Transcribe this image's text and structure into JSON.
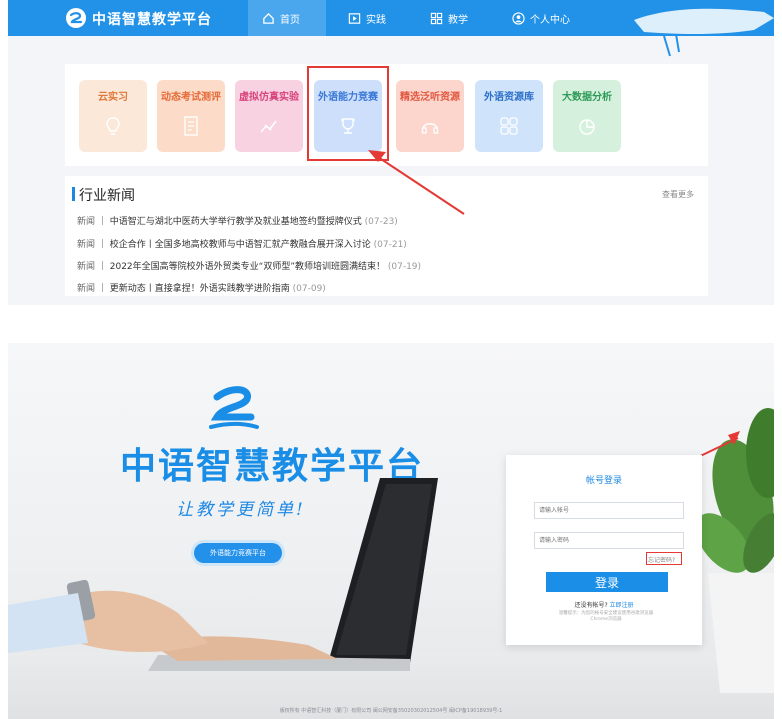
{
  "top": {
    "brand": "中语智慧教学平台",
    "nav": [
      {
        "label": "首页",
        "icon": "home-icon"
      },
      {
        "label": "实践",
        "icon": "play-icon"
      },
      {
        "label": "教学",
        "icon": "grid-icon"
      },
      {
        "label": "个人中心",
        "icon": "user-icon"
      }
    ],
    "cards": [
      {
        "title": "云实习",
        "icon": "lightbulb-icon",
        "bg": "#fbe8d8",
        "fg": "#e0783a"
      },
      {
        "title": "动态考试测评",
        "icon": "document-icon",
        "bg": "#fcdcc8",
        "fg": "#e56b3a"
      },
      {
        "title": "虚拟仿真实验",
        "icon": "chart-icon",
        "bg": "#f9d2e1",
        "fg": "#d9457c"
      },
      {
        "title": "外语能力竞赛",
        "icon": "trophy-icon",
        "bg": "#cddffb",
        "fg": "#3a78d8"
      },
      {
        "title": "精选泛听资源",
        "icon": "headphones-icon",
        "bg": "#fcd6cc",
        "fg": "#e2573f"
      },
      {
        "title": "外语资源库",
        "icon": "grid-icon",
        "bg": "#cfe3fb",
        "fg": "#2c6fc9"
      },
      {
        "title": "大数据分析",
        "icon": "pie-icon",
        "bg": "#d5f1de",
        "fg": "#2e9a57"
      }
    ],
    "news": {
      "title": "行业新闻",
      "more": "查看更多",
      "items": [
        {
          "tag": "新闻",
          "text": "中语智汇与湖北中医药大学举行教学及就业基地签约暨授牌仪式",
          "date": "(07-23)"
        },
        {
          "tag": "新闻",
          "text": "校企合作丨全国多地高校教师与中语智汇就产教融合展开深入讨论",
          "date": "(07-21)"
        },
        {
          "tag": "新闻",
          "text": "2022年全国高等院校外语外贸类专业“双师型”教师培训班圆满结束！",
          "date": "(07-19)"
        },
        {
          "tag": "新闻",
          "text": "更新动态丨直接拿捏！外语实践教学进阶指南",
          "date": "(07-09)"
        }
      ]
    }
  },
  "bottom": {
    "title": "中语智慧教学平台",
    "slogan": "让教学更简单!",
    "contest_button": "外语能力竞赛平台",
    "login": {
      "title": "帐号登录",
      "account_placeholder": "请输入帐号",
      "password_placeholder": "请输入密码",
      "forgot": "忘记密码?",
      "submit": "登录",
      "register_prompt": "还没有帐号?",
      "register_link": "立即注册",
      "tip": "温馨提示：为您的帐号安全建议使用谷歌浏览器Chrome浏览器"
    },
    "footer": "版权所有 中语智汇科技（厦门）有限公司    闽公网安备35020302012504号    闽ICP备19018939号-1"
  },
  "colors": {
    "nav_blue": "#2292e8",
    "highlight_red": "#e53935",
    "brand_blue": "#1a8ee6"
  }
}
